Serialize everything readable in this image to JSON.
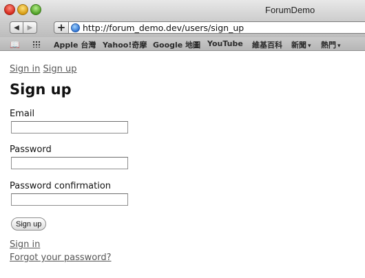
{
  "window": {
    "title": "ForumDemo"
  },
  "toolbar": {
    "back_icon": "◀",
    "forward_icon": "▶",
    "add_icon": "+",
    "url": "http://forum_demo.dev/users/sign_up"
  },
  "bookmarks": {
    "items": [
      {
        "label": "Apple 台灣"
      },
      {
        "label": "Yahoo!奇摩"
      },
      {
        "label": "Google 地圖"
      },
      {
        "label": "YouTube"
      },
      {
        "label": "維基百科"
      },
      {
        "label": "新聞"
      },
      {
        "label": "熱門"
      }
    ]
  },
  "nav": {
    "sign_in": "Sign in",
    "sign_up": "Sign up"
  },
  "form": {
    "heading": "Sign up",
    "email_label": "Email",
    "email_value": "",
    "password_label": "Password",
    "password_value": "",
    "password_confirmation_label": "Password confirmation",
    "password_confirmation_value": "",
    "submit_label": "Sign up"
  },
  "footer_links": {
    "sign_in": "Sign in",
    "forgot_password": "Forgot your password?"
  },
  "icons": {
    "book": "book-icon",
    "grid": "grid-icon",
    "globe": "globe-icon"
  }
}
